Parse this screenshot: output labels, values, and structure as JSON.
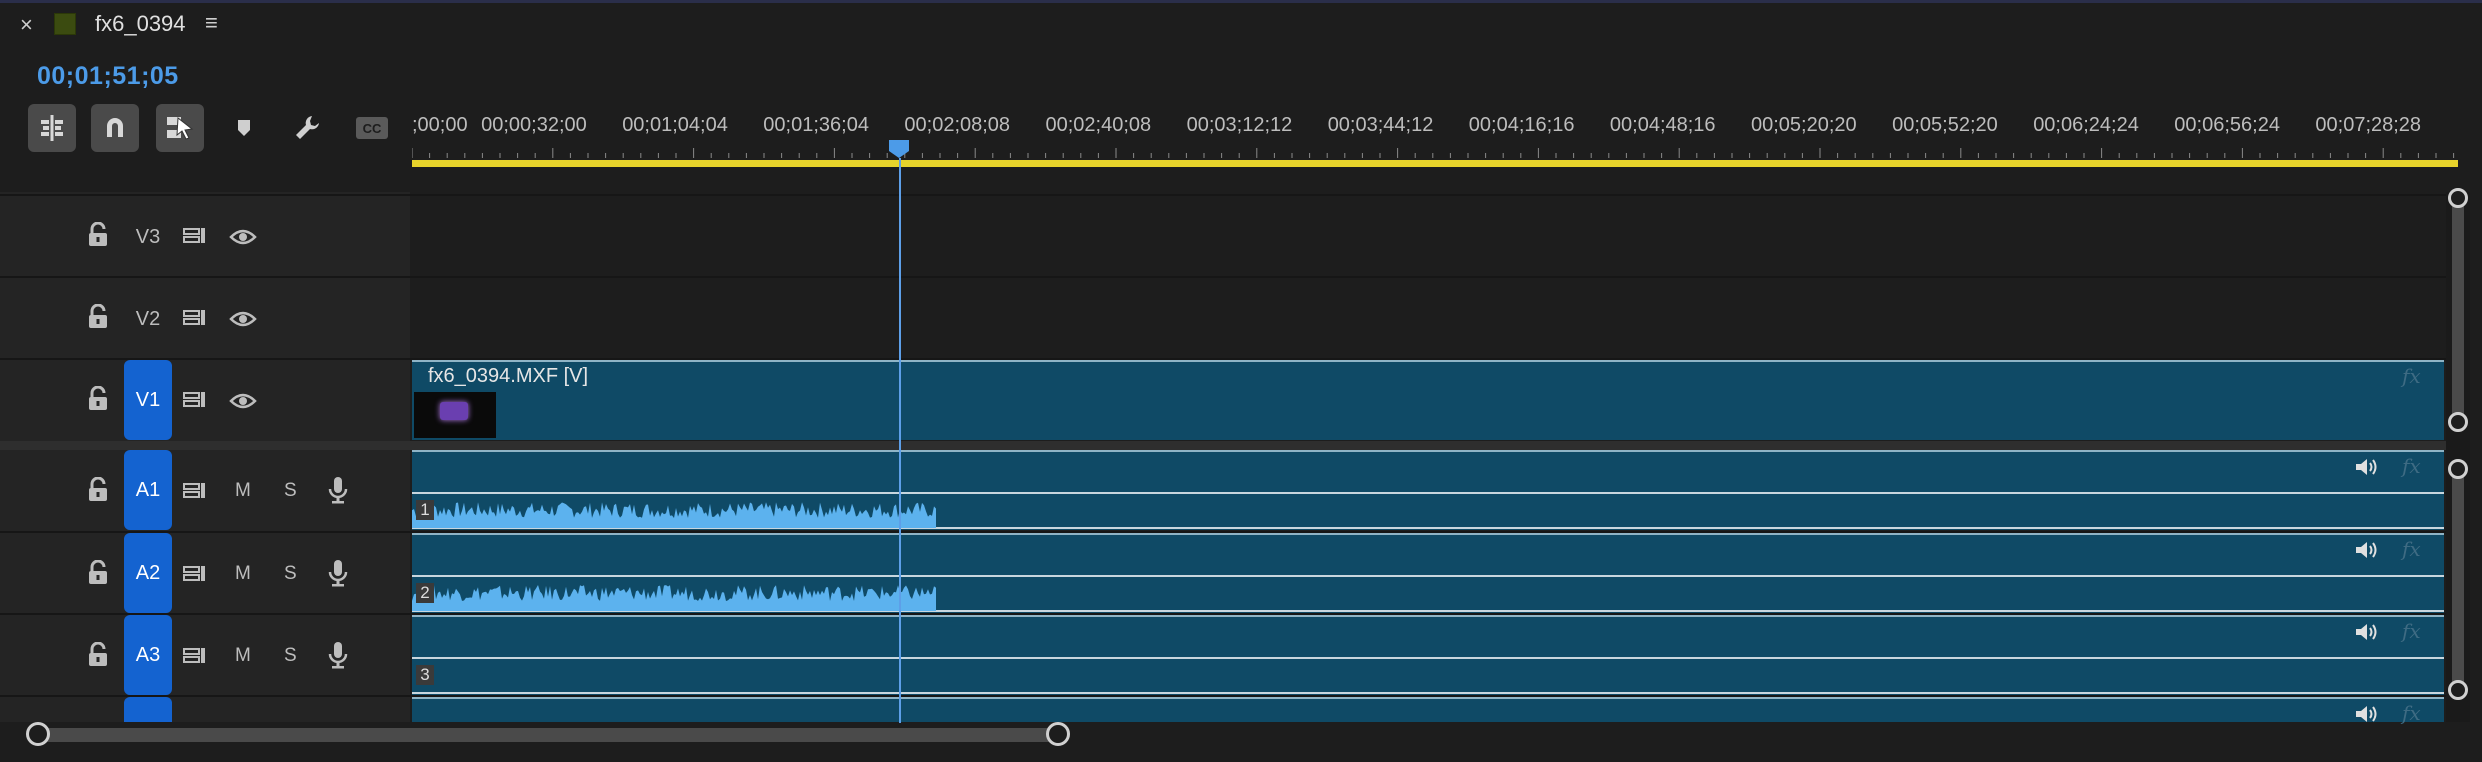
{
  "panel": {
    "close_glyph": "×",
    "sequence_name": "fx6_0394",
    "menu_glyph": "≡",
    "sequence_color": "#3b4b10"
  },
  "timecode": "00;01;51;05",
  "toolbar": [
    {
      "name": "insert-nest-icon",
      "active": true
    },
    {
      "name": "snap-magnet-icon",
      "active": true
    },
    {
      "name": "linked-selection-icon",
      "active": true
    },
    {
      "name": "add-marker-icon",
      "active": false
    },
    {
      "name": "timeline-settings-wrench-icon",
      "active": false
    },
    {
      "name": "captions-cc-icon",
      "active": false
    }
  ],
  "ruler": {
    "labels": [
      ";00;00",
      "00;00;32;00",
      "00;01;04;04",
      "00;01;36;04",
      "00;02;08;08",
      "00;02;40;08",
      "00;03;12;12",
      "00;03;44;12",
      "00;04;16;16",
      "00;04;48;16",
      "00;05;20;20",
      "00;05;52;20",
      "00;06;24;24",
      "00;06;56;24",
      "00;07;28;28"
    ]
  },
  "video_tracks": [
    {
      "label": "V3",
      "targeted": false
    },
    {
      "label": "V2",
      "targeted": false
    },
    {
      "label": "V1",
      "targeted": true
    }
  ],
  "audio_tracks": [
    {
      "label": "A1",
      "mute": "M",
      "solo": "S",
      "channel": "1"
    },
    {
      "label": "A2",
      "mute": "M",
      "solo": "S",
      "channel": "2"
    },
    {
      "label": "A3",
      "mute": "M",
      "solo": "S",
      "channel": "3"
    }
  ],
  "video_clip": {
    "name": "fx6_0394.MXF [V]",
    "fx": "fx"
  },
  "colors": {
    "accent": "#4c9be8",
    "target": "#1463d0",
    "clip": "#0f4a66",
    "work_area": "#e7d32b",
    "waveform": "#5cb2ee"
  }
}
